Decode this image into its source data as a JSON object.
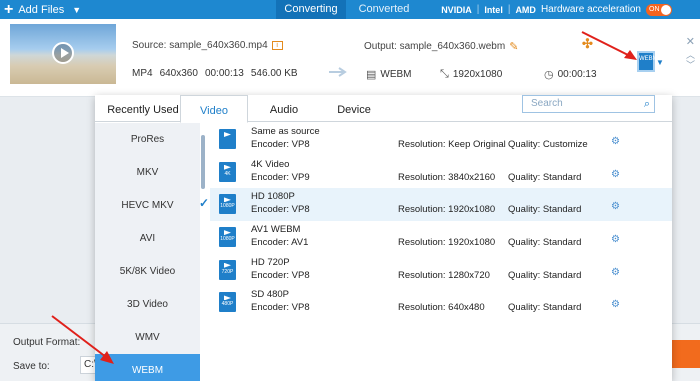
{
  "topbar": {
    "add_files": "Add Files",
    "tabs": [
      {
        "label": "Converting",
        "active": true
      },
      {
        "label": "Converted",
        "active": false
      }
    ],
    "gpu_brands": [
      "NVIDIA",
      "Intel",
      "AMD"
    ],
    "hw_accel_label": "Hardware acceleration",
    "hw_toggle": "ON"
  },
  "file": {
    "source": "Source: sample_640x360.mp4",
    "meta": [
      "MP4",
      "640x360",
      "00:00:13",
      "546.00 KB"
    ],
    "output": "Output: sample_640x360.webm",
    "out_format": "WEBM",
    "out_resolution": "1920x1080",
    "out_duration": "00:00:13",
    "format_button_text": "WEBM"
  },
  "bottom": {
    "output_format_label": "Output Format:",
    "save_to_label": "Save to:",
    "save_to_value": "C:\\"
  },
  "panel": {
    "tabs": [
      {
        "label": "Recently Used",
        "active": false
      },
      {
        "label": "Video",
        "active": true
      },
      {
        "label": "Audio",
        "active": false
      },
      {
        "label": "Device",
        "active": false
      }
    ],
    "search_placeholder": "Search",
    "categories": [
      {
        "label": "ProRes",
        "active": false
      },
      {
        "label": "MKV",
        "active": false
      },
      {
        "label": "HEVC MKV",
        "active": false
      },
      {
        "label": "AVI",
        "active": false
      },
      {
        "label": "5K/8K Video",
        "active": false
      },
      {
        "label": "3D Video",
        "active": false
      },
      {
        "label": "WMV",
        "active": false
      },
      {
        "label": "WEBM",
        "active": true
      }
    ],
    "presets": [
      {
        "name": "Same as source",
        "encoder": "Encoder: VP8",
        "resolution": "Resolution: Keep Original",
        "quality": "Quality: Customize",
        "badge": "",
        "selected": false
      },
      {
        "name": "4K Video",
        "encoder": "Encoder: VP9",
        "resolution": "Resolution: 3840x2160",
        "quality": "Quality: Standard",
        "badge": "4K",
        "selected": false
      },
      {
        "name": "HD 1080P",
        "encoder": "Encoder: VP8",
        "resolution": "Resolution: 1920x1080",
        "quality": "Quality: Standard",
        "badge": "1080P",
        "selected": true
      },
      {
        "name": "AV1 WEBM",
        "encoder": "Encoder: AV1",
        "resolution": "Resolution: 1920x1080",
        "quality": "Quality: Standard",
        "badge": "1080P",
        "selected": false
      },
      {
        "name": "HD 720P",
        "encoder": "Encoder: VP8",
        "resolution": "Resolution: 1280x720",
        "quality": "Quality: Standard",
        "badge": "720P",
        "selected": false
      },
      {
        "name": "SD 480P",
        "encoder": "Encoder: VP8",
        "resolution": "Resolution: 640x480",
        "quality": "Quality: Standard",
        "badge": "480P",
        "selected": false
      }
    ]
  },
  "colors": {
    "accent": "#1f7fc9",
    "topbar": "#1e88d0",
    "orange": "#f26b1d",
    "annotation": "#e0201a"
  }
}
